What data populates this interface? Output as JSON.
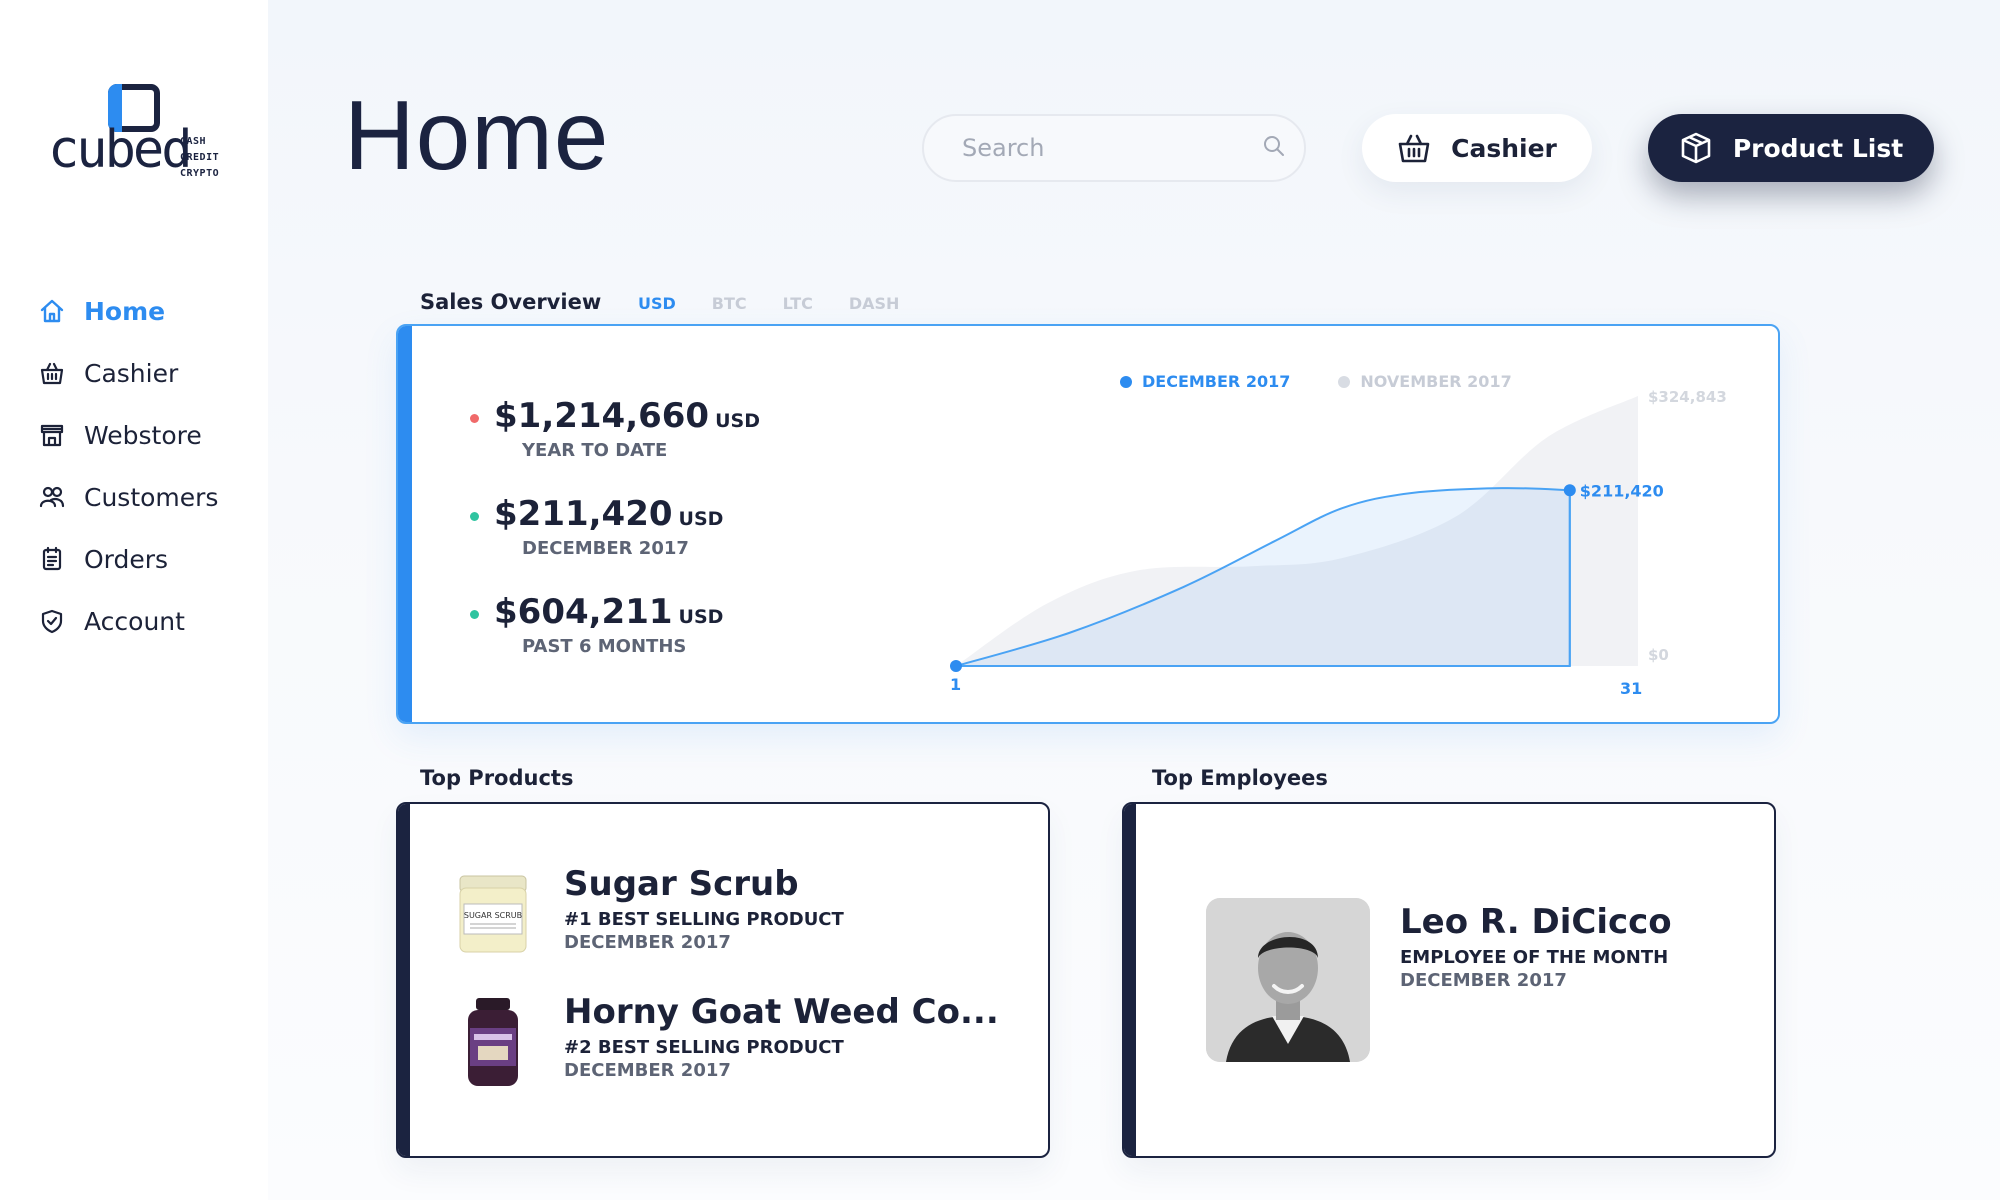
{
  "brand": {
    "word": "cubed",
    "tags": [
      "CASH",
      "CREDIT",
      "CRYPTO"
    ],
    "accent": "#2d8cf0",
    "dark": "#1b2340"
  },
  "sidebar": {
    "items": [
      {
        "label": "Home",
        "icon": "home-icon",
        "active": true
      },
      {
        "label": "Cashier",
        "icon": "basket-icon",
        "active": false
      },
      {
        "label": "Webstore",
        "icon": "store-icon",
        "active": false
      },
      {
        "label": "Customers",
        "icon": "users-icon",
        "active": false
      },
      {
        "label": "Orders",
        "icon": "clipboard-icon",
        "active": false
      },
      {
        "label": "Account",
        "icon": "shield-icon",
        "active": false
      }
    ]
  },
  "header": {
    "title": "Home",
    "search_placeholder": "Search",
    "cashier_label": "Cashier",
    "product_list_label": "Product List"
  },
  "sales": {
    "section_title": "Sales Overview",
    "tabs": [
      {
        "label": "USD",
        "active": true
      },
      {
        "label": "BTC",
        "active": false
      },
      {
        "label": "LTC",
        "active": false
      },
      {
        "label": "DASH",
        "active": false
      }
    ],
    "stats": [
      {
        "amount": "$1,214,660",
        "unit": "USD",
        "label": "YEAR TO DATE",
        "dot_color": "#f06a6a"
      },
      {
        "amount": "$211,420",
        "unit": "USD",
        "label": "DECEMBER 2017",
        "dot_color": "#2fc4a0"
      },
      {
        "amount": "$604,211",
        "unit": "USD",
        "label": "PAST 6 MONTHS",
        "dot_color": "#2fc4a0"
      }
    ],
    "legend": [
      {
        "label": "DECEMBER 2017",
        "color": "#2d8cf0"
      },
      {
        "label": "NOVEMBER 2017",
        "color": "#d8dce3"
      }
    ],
    "y_max_label": "$324,843",
    "y_min_label": "$0",
    "x_start_label": "1",
    "x_end_label": "31",
    "current_value_label": "$211,420"
  },
  "chart_data": {
    "type": "area",
    "title": "",
    "xlabel": "",
    "ylabel": "",
    "xlim": [
      1,
      31
    ],
    "ylim": [
      0,
      324843
    ],
    "series": [
      {
        "name": "DECEMBER 2017",
        "x": [
          1,
          6,
          11,
          15,
          18,
          21,
          25,
          28
        ],
        "y": [
          0,
          40000,
          95000,
          150000,
          190000,
          208000,
          214000,
          211420
        ]
      },
      {
        "name": "NOVEMBER 2017",
        "x": [
          1,
          5,
          9,
          14,
          18,
          23,
          27,
          31
        ],
        "y": [
          0,
          75000,
          115000,
          120000,
          130000,
          180000,
          275000,
          324843
        ]
      }
    ],
    "grid": false,
    "legend_position": "top"
  },
  "top_products": {
    "section_title": "Top Products",
    "items": [
      {
        "name": "Sugar Scrub",
        "rank": "#1 BEST SELLING PRODUCT",
        "date": "DECEMBER 2017",
        "image": "sugar-scrub-jar",
        "jar_label": "SUGAR SCRUB"
      },
      {
        "name": "Horny Goat Weed Co...",
        "rank": "#2 BEST SELLING PRODUCT",
        "date": "DECEMBER 2017",
        "image": "supplement-bottle"
      }
    ]
  },
  "top_employees": {
    "section_title": "Top Employees",
    "items": [
      {
        "name": "Leo R. DiCicco",
        "title": "EMPLOYEE OF THE MONTH",
        "date": "DECEMBER 2017",
        "image": "employee-photo"
      }
    ]
  }
}
